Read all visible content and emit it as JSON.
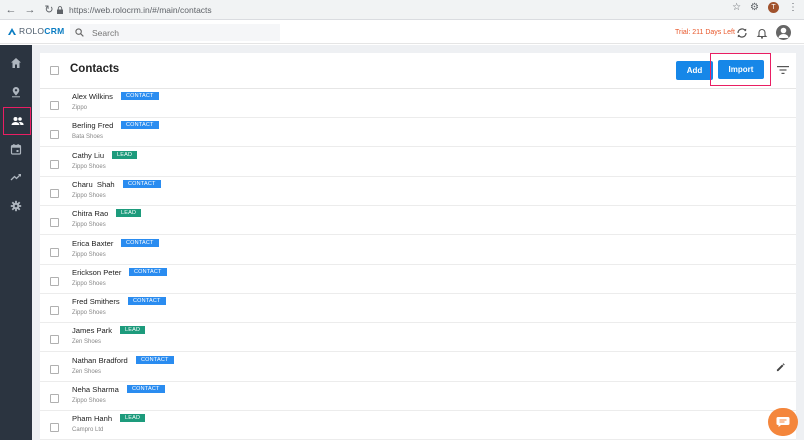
{
  "browser": {
    "url": "https://web.rolocrm.in/#/main/contacts",
    "profile_initial": "T"
  },
  "app": {
    "logo_rolo": "ROLO",
    "logo_crm": "CRM",
    "search_placeholder": "Search",
    "trial_text": "Trial: 211 Days Left"
  },
  "page": {
    "title": "Contacts",
    "add_label": "Add",
    "import_label": "Import"
  },
  "colors": {
    "accent": "#1687e8",
    "contact_badge": "#2a8cf0",
    "lead_badge": "#1d9b7c",
    "sidebar": "#2b3440",
    "highlight": "#e91e63",
    "trial": "#e8572a"
  },
  "sidebar": {
    "items": [
      {
        "icon": "home-icon"
      },
      {
        "icon": "location-pin-icon"
      },
      {
        "icon": "contacts-icon",
        "active": true
      },
      {
        "icon": "calendar-icon"
      },
      {
        "icon": "trending-icon"
      },
      {
        "icon": "settings-icon"
      }
    ]
  },
  "contacts": [
    {
      "name": "Alex Wilkins",
      "company": "Zippo",
      "type": "CONTACT"
    },
    {
      "name": "Berling Fred",
      "company": "Bata Shoes",
      "type": "CONTACT"
    },
    {
      "name": "Cathy Liu",
      "company": "Zippo Shoes",
      "type": "LEAD"
    },
    {
      "name": "Charu  Shah",
      "company": "Zippo Shoes",
      "type": "CONTACT"
    },
    {
      "name": "Chitra Rao",
      "company": "Zippo Shoes",
      "type": "LEAD"
    },
    {
      "name": "Erica Baxter",
      "company": "Zippo Shoes",
      "type": "CONTACT"
    },
    {
      "name": "Erickson Peter",
      "company": "Zippo Shoes",
      "type": "CONTACT"
    },
    {
      "name": "Fred Smithers",
      "company": "Zippo Shoes",
      "type": "CONTACT"
    },
    {
      "name": "James Park",
      "company": "Zen Shoes",
      "type": "LEAD"
    },
    {
      "name": "Nathan Bradford",
      "company": "Zen Shoes",
      "type": "CONTACT"
    },
    {
      "name": "Neha Sharma",
      "company": "Zippo Shoes",
      "type": "CONTACT"
    },
    {
      "name": "Pham Hanh",
      "company": "Campro Ltd",
      "type": "LEAD"
    }
  ]
}
